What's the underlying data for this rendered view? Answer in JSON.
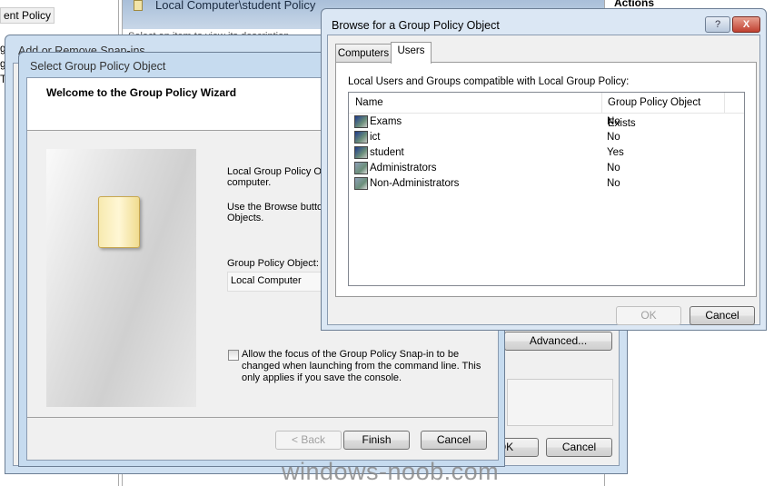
{
  "background": {
    "left_pane": {
      "item": "ent Policy",
      "fragments": [
        "g",
        "g",
        "T"
      ]
    },
    "main_header": {
      "title": "Local Computer\\student Policy",
      "subtitle": "Select an item to view its description"
    },
    "actions_header": "Actions"
  },
  "snapins_dialog": {
    "title": "Add or Remove Snap-ins",
    "advanced_label": "Advanced...",
    "ok_label": "OK",
    "cancel_label": "Cancel"
  },
  "wizard": {
    "title": "Select Group Policy Object",
    "heading": "Welcome to the Group Policy Wizard",
    "text1": "Local Group Policy Ob",
    "text1b": "computer.",
    "text2": "Use the Browse butto",
    "text2b": "Objects.",
    "gpo_label": "Group Policy Object:",
    "gpo_value": "Local Computer",
    "checkbox_label": "Allow the focus of the Group Policy Snap-in to be changed when launching from the command line.  This only applies if you save the console.",
    "checkbox_checked": false,
    "back_label": "< Back",
    "finish_label": "Finish",
    "cancel_label": "Cancel"
  },
  "browse": {
    "title": "Browse for a Group Policy Object",
    "help_label": "?",
    "close_label": "X",
    "tabs": [
      {
        "label": "Computers",
        "active": false
      },
      {
        "label": "Users",
        "active": true
      }
    ],
    "caption": "Local Users and Groups compatible with Local Group Policy:",
    "columns": [
      "Name",
      "Group Policy Object Exists"
    ],
    "rows": [
      {
        "name": "Exams",
        "exists": "No",
        "icon": "user-icon"
      },
      {
        "name": "ict",
        "exists": "No",
        "icon": "user-icon"
      },
      {
        "name": "student",
        "exists": "Yes",
        "icon": "user-icon"
      },
      {
        "name": "Administrators",
        "exists": "No",
        "icon": "group-icon"
      },
      {
        "name": "Non-Administrators",
        "exists": "No",
        "icon": "group-icon"
      }
    ],
    "ok_label": "OK",
    "cancel_label": "Cancel"
  },
  "watermark": "windows-noob.com"
}
